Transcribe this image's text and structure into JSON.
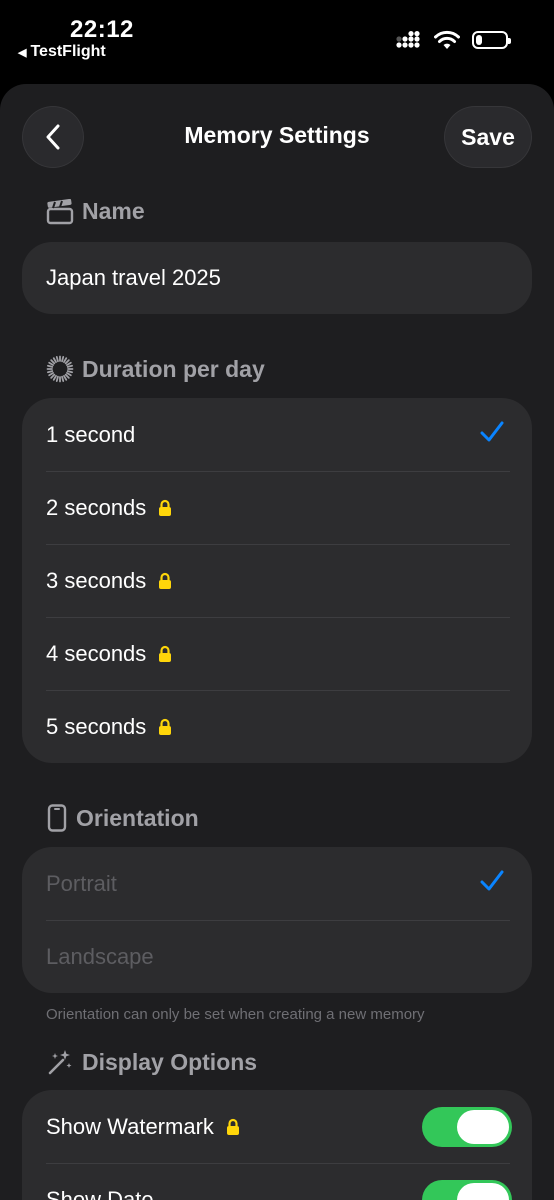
{
  "status_bar": {
    "time": "22:12",
    "back_app": "TestFlight",
    "icons": [
      "cellular-signal-icon",
      "wifi-icon",
      "battery-icon"
    ],
    "battery_level": 0.2
  },
  "nav": {
    "title": "Memory Settings",
    "save_label": "Save"
  },
  "name_section": {
    "header": "Name",
    "value": "Japan travel 2025"
  },
  "duration_section": {
    "header": "Duration per day",
    "options": [
      {
        "label": "1 second",
        "selected": true,
        "locked": false
      },
      {
        "label": "2 seconds",
        "selected": false,
        "locked": true
      },
      {
        "label": "3 seconds",
        "selected": false,
        "locked": true
      },
      {
        "label": "4 seconds",
        "selected": false,
        "locked": true
      },
      {
        "label": "5 seconds",
        "selected": false,
        "locked": true
      }
    ]
  },
  "orientation_section": {
    "header": "Orientation",
    "options": [
      {
        "label": "Portrait",
        "selected": true
      },
      {
        "label": "Landscape",
        "selected": false
      }
    ],
    "footer": "Orientation can only be set when creating a new memory"
  },
  "display_section": {
    "header": "Display Options",
    "options": [
      {
        "label": "Show Watermark",
        "locked": true,
        "on": true
      },
      {
        "label": "Show Date",
        "locked": false,
        "on": true
      }
    ]
  },
  "colors": {
    "accent": "#0a84ff",
    "lock": "#ffd60a",
    "toggle_on": "#33c759"
  }
}
